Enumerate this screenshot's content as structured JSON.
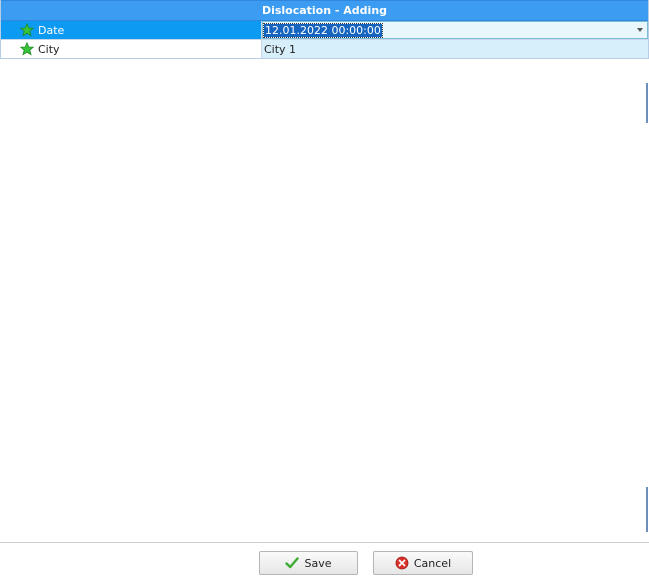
{
  "window": {
    "title": "Dislocation - Adding"
  },
  "fields": [
    {
      "label": "Date",
      "value": "12.01.2022 00:00:00",
      "icon": "star-icon",
      "selected": true
    },
    {
      "label": "City",
      "value": "City 1",
      "icon": "star-icon",
      "selected": false
    }
  ],
  "buttons": {
    "save_label": "Save",
    "cancel_label": "Cancel",
    "save_icon": "checkmark-icon",
    "cancel_icon": "cancel-icon"
  },
  "colors": {
    "title_bar": "#3b9cf2",
    "selected_row": "#0d9af2",
    "value_cell": "#d6effb",
    "star": "#2ecc40"
  }
}
